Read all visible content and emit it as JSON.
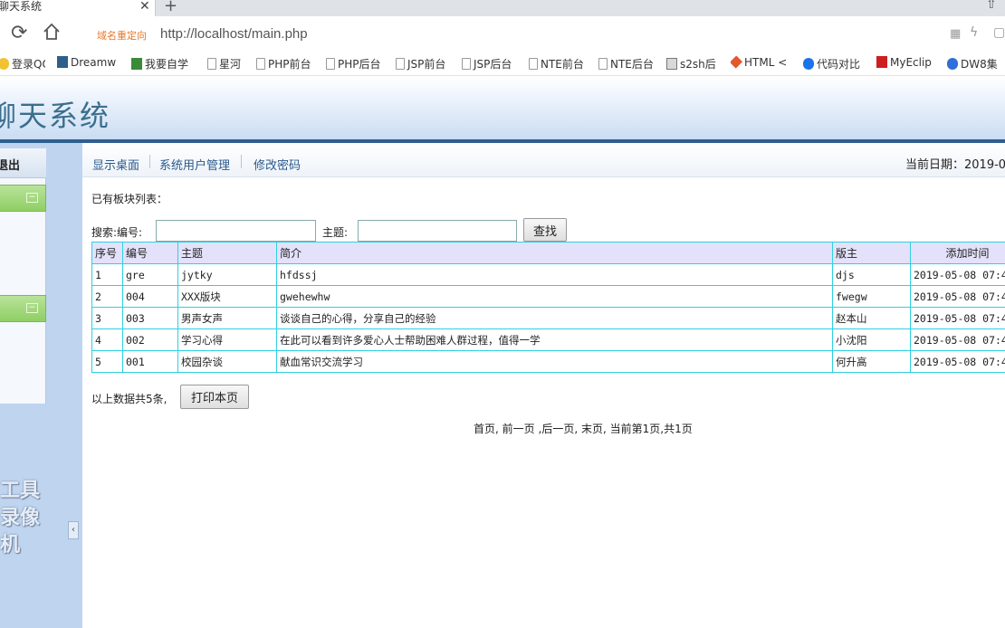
{
  "browser": {
    "tab_title": "聊天系统",
    "redirect_label": "域名重定向",
    "url": "http://localhost/main.php",
    "bookmarks": [
      "登录QQ",
      "Dreamw",
      "我要自学",
      "星河",
      "PHP前台",
      "PHP后台",
      "JSP前台",
      "JSP后台",
      "NTE前台",
      "NTE后台",
      "s2sh后",
      "HTML <",
      "代码对比",
      "MyEclip",
      "DW8集"
    ]
  },
  "app": {
    "title": "聊天系统"
  },
  "sidebar": {
    "logout_label": "退出",
    "watermark": "工具 录像机"
  },
  "nav": {
    "items": [
      "显示桌面",
      "系统用户管理",
      "修改密码"
    ],
    "date_label": "当前日期：2019-0"
  },
  "main": {
    "list_title": "已有板块列表：",
    "search": {
      "label_code": "搜索:编号:",
      "label_subject": "主题:",
      "code_value": "",
      "subject_value": "",
      "button": "查找"
    },
    "table": {
      "headers": [
        "序号",
        "编号",
        "主题",
        "简介",
        "版主",
        "添加时间"
      ],
      "rows": [
        [
          "1",
          "gre",
          "jytky",
          "hfdssj",
          "djs",
          "2019-05-08 07:4"
        ],
        [
          "2",
          "004",
          "XXX版块",
          "gwehewhw",
          "fwegw",
          "2019-05-08 07:4"
        ],
        [
          "3",
          "003",
          "男声女声",
          "谈谈自己的心得，分享自己的经验",
          "赵本山",
          "2019-05-08 07:4"
        ],
        [
          "4",
          "002",
          "学习心得",
          "在此可以看到许多爱心人士帮助困难人群过程，值得一学",
          "小沈阳",
          "2019-05-08 07:4"
        ],
        [
          "5",
          "001",
          "校园杂谈",
          "献血常识交流学习",
          "何升高",
          "2019-05-08 07:4"
        ]
      ]
    },
    "count_text": "以上数据共5条,",
    "print_button": "打印本页",
    "pager": [
      "首页,",
      "前一页",
      ",后一页,",
      "末页,",
      "当前第1页,共1页"
    ]
  }
}
